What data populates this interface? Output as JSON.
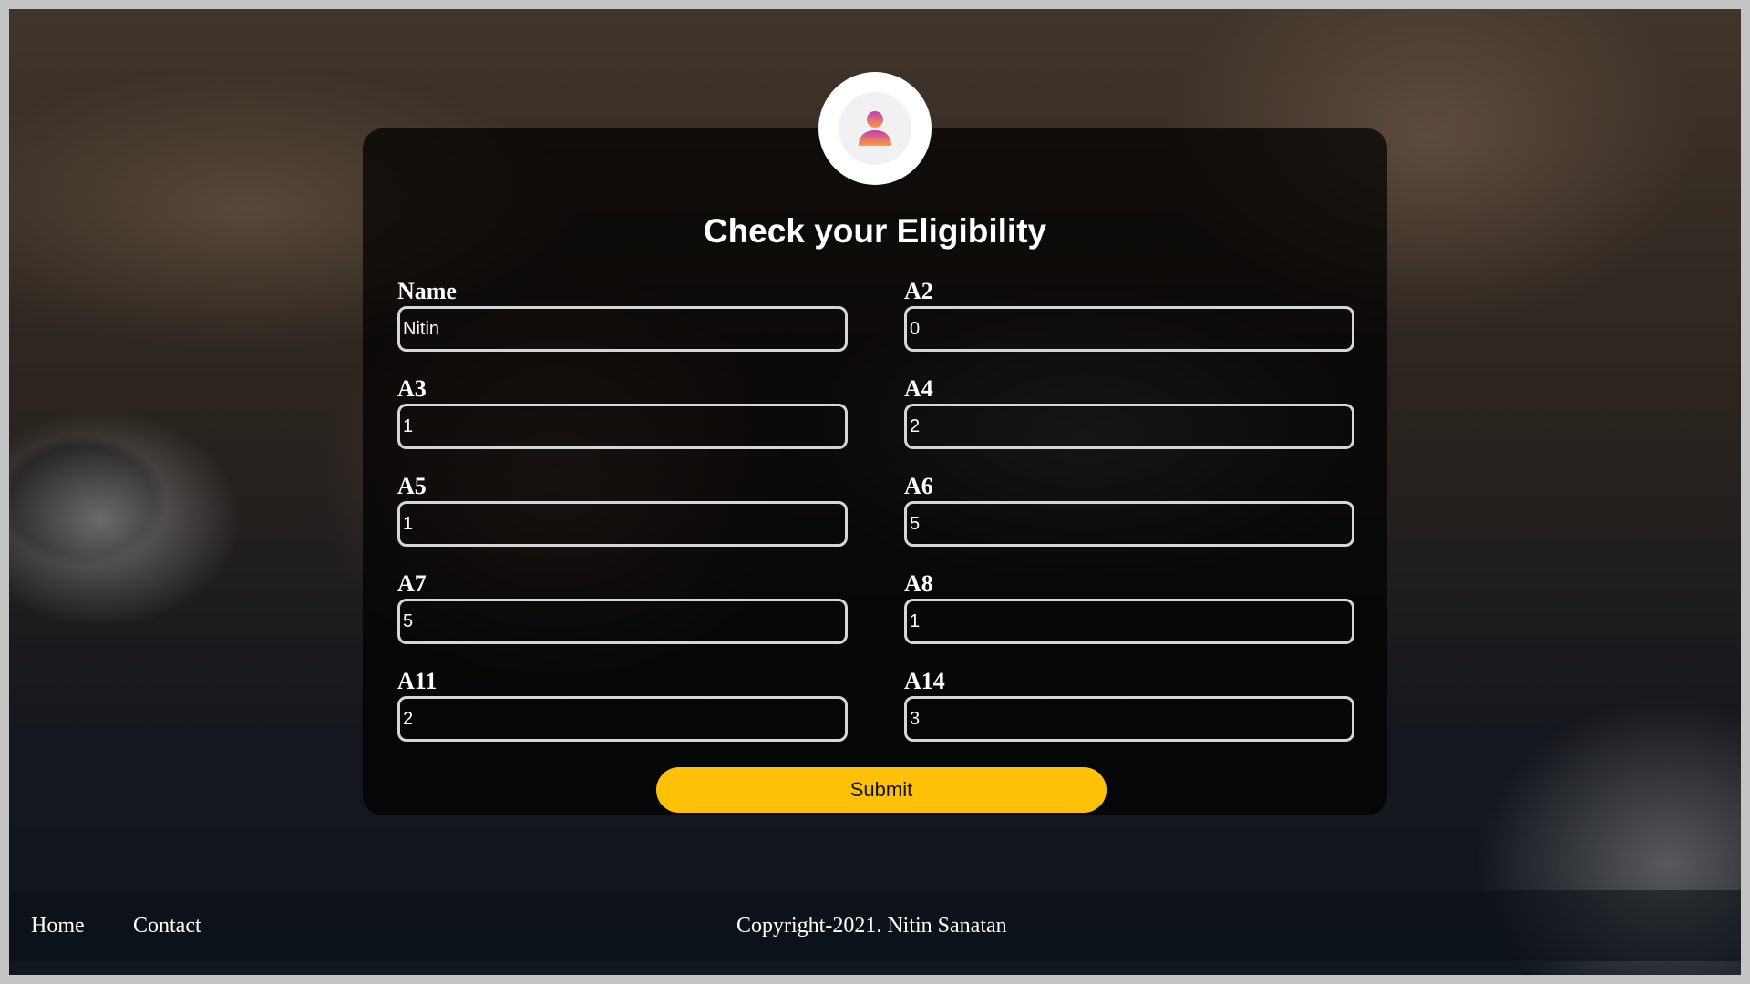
{
  "form": {
    "title": "Check your Eligibility",
    "avatar_icon": "user-icon",
    "fields": [
      {
        "label": "Name",
        "value": "Nitin"
      },
      {
        "label": "A2",
        "value": "0"
      },
      {
        "label": "A3",
        "value": "1"
      },
      {
        "label": "A4",
        "value": "2"
      },
      {
        "label": "A5",
        "value": "1"
      },
      {
        "label": "A6",
        "value": "5"
      },
      {
        "label": "A7",
        "value": "5"
      },
      {
        "label": "A8",
        "value": "1"
      },
      {
        "label": "A11",
        "value": "2"
      },
      {
        "label": "A14",
        "value": "3"
      }
    ],
    "submit_label": "Submit"
  },
  "footer": {
    "nav": [
      {
        "label": "Home"
      },
      {
        "label": "Contact"
      }
    ],
    "copyright": "Copyright-2021. Nitin Sanatan"
  },
  "colors": {
    "submit_button": "#ffc107",
    "avatar_gradient_top": "#c13cb6",
    "avatar_gradient_bottom": "#ff9a3c"
  }
}
